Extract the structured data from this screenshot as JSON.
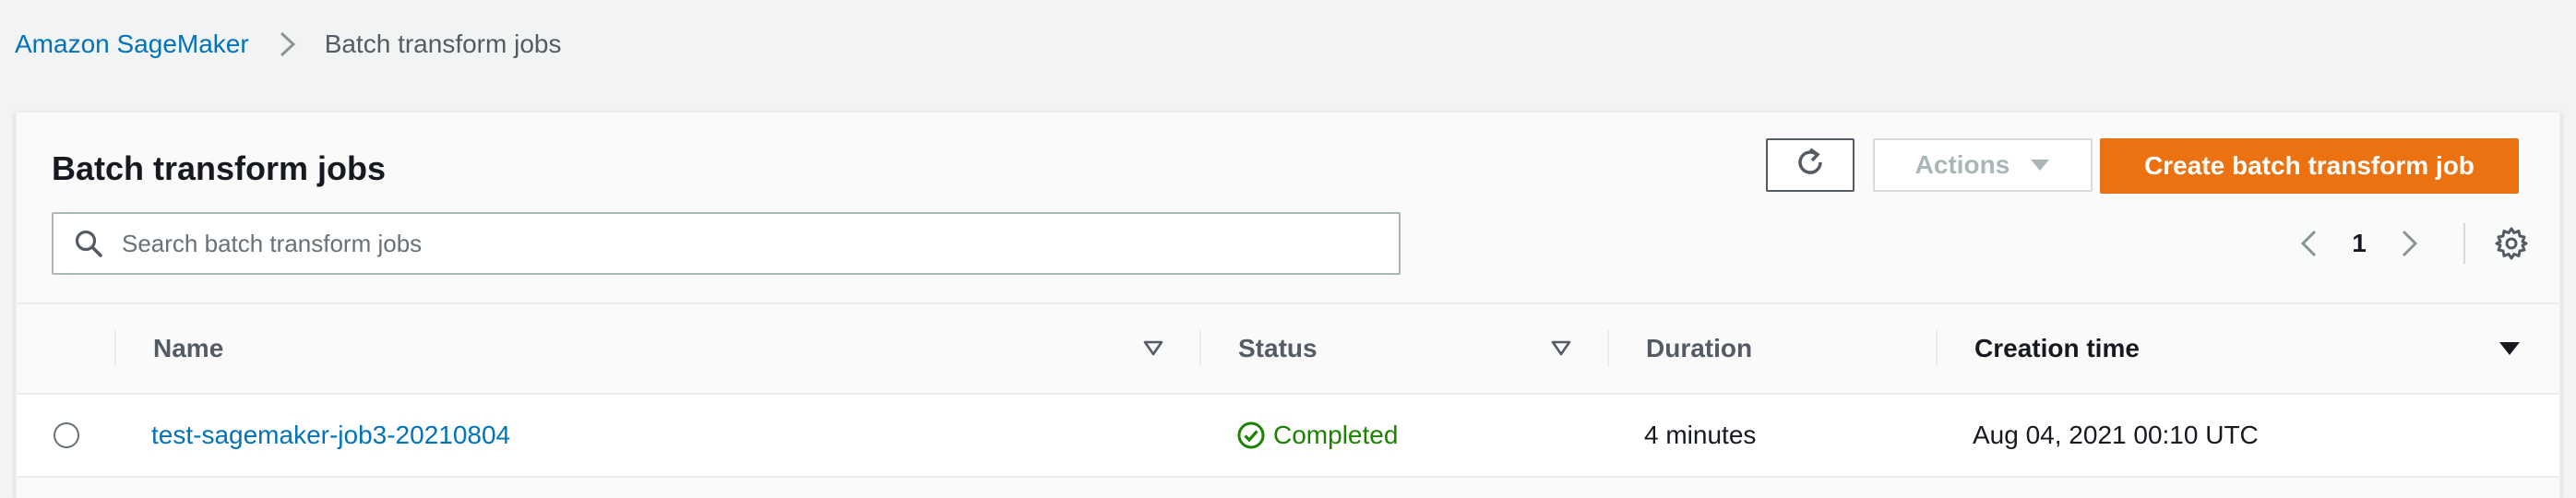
{
  "breadcrumb": {
    "root": "Amazon SageMaker",
    "current": "Batch transform jobs"
  },
  "panel": {
    "title": "Batch transform jobs"
  },
  "toolbar": {
    "actions_label": "Actions",
    "create_label": "Create batch transform job"
  },
  "search": {
    "placeholder": "Search batch transform jobs",
    "value": ""
  },
  "pagination": {
    "current_page": "1"
  },
  "table": {
    "columns": [
      {
        "label": "Name"
      },
      {
        "label": "Status"
      },
      {
        "label": "Duration"
      },
      {
        "label": "Creation time"
      }
    ],
    "rows": [
      {
        "name": "test-sagemaker-job3-20210804",
        "status": "Completed",
        "duration": "4 minutes",
        "creation_time": "Aug 04, 2021 00:10 UTC"
      }
    ]
  },
  "colors": {
    "link": "#0073bb",
    "primary_button": "#ec7211",
    "success": "#1d8102",
    "background": "#f2f3f3"
  },
  "icons": {
    "breadcrumb_separator": "chevron-right-icon",
    "refresh": "refresh-icon",
    "actions_caret": "caret-down-icon",
    "search": "search-icon",
    "prev_page": "chevron-left-icon",
    "next_page": "chevron-right-icon",
    "settings": "gear-icon",
    "sort": "sort-caret-icon",
    "status": "check-circle-icon"
  }
}
